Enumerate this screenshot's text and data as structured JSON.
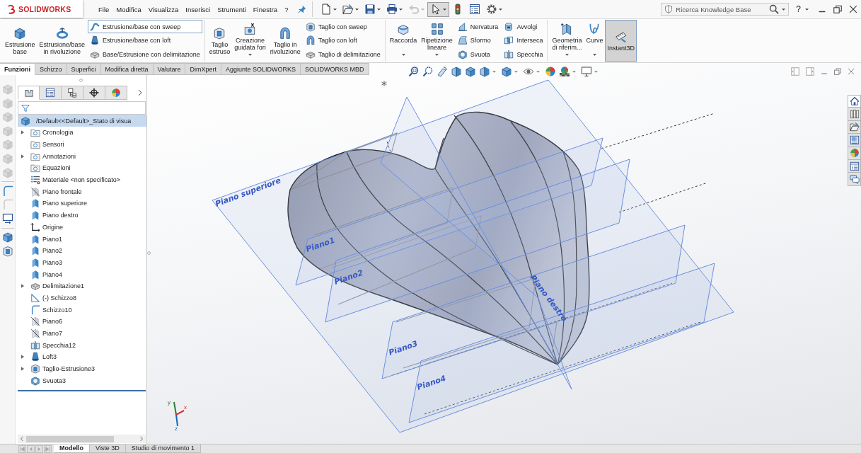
{
  "title_bar": {
    "logo": "SOLIDWORKS",
    "menu": [
      "File",
      "Modifica",
      "Visualizza",
      "Inserisci",
      "Strumenti",
      "Finestra",
      "?"
    ],
    "quick_access": [
      {
        "dropdown": true,
        "disabled": false,
        "selected": false
      },
      {
        "dropdown": true,
        "disabled": false,
        "selected": false
      },
      {
        "dropdown": true,
        "disabled": false,
        "selected": false
      },
      {
        "dropdown": true,
        "disabled": false,
        "selected": false
      },
      {
        "dropdown": true,
        "disabled": true,
        "selected": false
      },
      {
        "dropdown": true,
        "disabled": false,
        "selected": true
      },
      {
        "dropdown": false,
        "disabled": false,
        "selected": false
      },
      {
        "dropdown": false,
        "disabled": false,
        "selected": false
      },
      {
        "dropdown": true,
        "disabled": false,
        "selected": false
      }
    ],
    "search": {
      "placeholder": "Ricerca Knowledge Base"
    },
    "help": "?"
  },
  "command_manager": {
    "groups": [
      {
        "items": [
          {
            "kind": "large",
            "lines": [
              "Estrusione",
              "base"
            ],
            "dropdown": false,
            "on": false
          },
          {
            "kind": "large",
            "lines": [
              "Estrusione/base",
              "in rivoluzione"
            ],
            "dropdown": false,
            "on": false
          },
          {
            "kind": "stack",
            "entries": [
              {
                "label": "Estrusione/base con sweep",
                "highlighted": true
              },
              {
                "label": "Estrusione/base con loft",
                "highlighted": false
              },
              {
                "label": "Base/Estrusione con delimitazione",
                "highlighted": false
              }
            ]
          }
        ]
      },
      {
        "items": [
          {
            "kind": "large",
            "lines": [
              "Taglio",
              "estruso"
            ],
            "dropdown": false,
            "on": false
          },
          {
            "kind": "large",
            "lines": [
              "Creazione",
              "guidata fori"
            ],
            "dropdown": true,
            "on": false
          },
          {
            "kind": "large",
            "lines": [
              "Taglio in",
              "rivoluzione"
            ],
            "dropdown": false,
            "on": false
          },
          {
            "kind": "stack",
            "entries": [
              {
                "label": "Taglio con sweep",
                "highlighted": false
              },
              {
                "label": "Taglio con loft",
                "highlighted": false
              },
              {
                "label": "Taglio di delimitazione",
                "highlighted": false
              }
            ]
          }
        ]
      },
      {
        "items": [
          {
            "kind": "large",
            "lines": [
              "Raccorda"
            ],
            "dropdown": true,
            "on": false
          },
          {
            "kind": "large",
            "lines": [
              "Ripetizione",
              "lineare"
            ],
            "dropdown": true,
            "on": false
          },
          {
            "kind": "stack",
            "entries": [
              {
                "label": "Nervatura",
                "highlighted": false
              },
              {
                "label": "Sformo",
                "highlighted": false
              },
              {
                "label": "Svuota",
                "highlighted": false
              }
            ]
          },
          {
            "kind": "stack",
            "entries": [
              {
                "label": "Avvolgi",
                "highlighted": false
              },
              {
                "label": "Interseca",
                "highlighted": false
              },
              {
                "label": "Specchia",
                "highlighted": false
              }
            ]
          }
        ]
      },
      {
        "items": [
          {
            "kind": "large",
            "lines": [
              "Geometria",
              "di riferim..."
            ],
            "dropdown": true,
            "on": false
          },
          {
            "kind": "large",
            "lines": [
              "Curve"
            ],
            "dropdown": true,
            "on": false
          },
          {
            "kind": "large",
            "lines": [
              "Instant3D"
            ],
            "dropdown": false,
            "on": true
          }
        ]
      }
    ]
  },
  "command_tabs": [
    {
      "label": "Funzioni",
      "selected": true
    },
    {
      "label": "Schizzo",
      "selected": false
    },
    {
      "label": "Superfici",
      "selected": false
    },
    {
      "label": "Modifica diretta",
      "selected": false
    },
    {
      "label": "Valutare",
      "selected": false
    },
    {
      "label": "DimXpert",
      "selected": false
    },
    {
      "label": "Aggiunte SOLIDWORKS",
      "selected": false
    },
    {
      "label": "SOLIDWORKS MBD",
      "selected": false
    }
  ],
  "side_toolbar": [
    {
      "disabled": true
    },
    {
      "disabled": true
    },
    {
      "disabled": true
    },
    {
      "disabled": true
    },
    {
      "disabled": true
    },
    {
      "disabled": true
    },
    {
      "disabled": true
    },
    {
      "disabled": false
    },
    {
      "disabled": true
    },
    {
      "disabled": false
    },
    {
      "disabled": false
    },
    {
      "disabled": false
    }
  ],
  "feature_manager": {
    "tabs": [
      {
        "selected": true
      },
      {
        "selected": false
      },
      {
        "selected": false
      },
      {
        "selected": false
      },
      {
        "selected": false
      }
    ],
    "root": {
      "label": "/Default<<Default>_Stato di visua",
      "selected": true
    },
    "items": [
      {
        "label": "Cronologia",
        "kind": "folder",
        "has_children": true,
        "hidden": false,
        "selected": false
      },
      {
        "label": "Sensori",
        "kind": "folder",
        "has_children": false,
        "hidden": false,
        "selected": false
      },
      {
        "label": "Annotazioni",
        "kind": "folder",
        "has_children": true,
        "hidden": false,
        "selected": false
      },
      {
        "label": "Equazioni",
        "kind": "folder",
        "has_children": false,
        "hidden": false,
        "selected": false
      },
      {
        "label": "Materiale <non specificato>",
        "kind": "material",
        "has_children": false,
        "hidden": false,
        "selected": false
      },
      {
        "label": "Piano frontale",
        "kind": "plane",
        "has_children": false,
        "hidden": true,
        "selected": false
      },
      {
        "label": "Piano superiore",
        "kind": "plane",
        "has_children": false,
        "hidden": false,
        "selected": false
      },
      {
        "label": "Piano destro",
        "kind": "plane",
        "has_children": false,
        "hidden": false,
        "selected": false
      },
      {
        "label": "Origine",
        "kind": "origin",
        "has_children": false,
        "hidden": false,
        "selected": false
      },
      {
        "label": "Piano1",
        "kind": "plane",
        "has_children": false,
        "hidden": false,
        "selected": false
      },
      {
        "label": "Piano2",
        "kind": "plane",
        "has_children": false,
        "hidden": false,
        "selected": false
      },
      {
        "label": "Piano3",
        "kind": "plane",
        "has_children": false,
        "hidden": false,
        "selected": false
      },
      {
        "label": "Piano4",
        "kind": "plane",
        "has_children": false,
        "hidden": false,
        "selected": false
      },
      {
        "label": "Delimitazione1",
        "kind": "boundary",
        "has_children": true,
        "hidden": false,
        "selected": false
      },
      {
        "label": "(-) Schizzo8",
        "kind": "sketch3d",
        "has_children": false,
        "hidden": false,
        "selected": false
      },
      {
        "label": "Schizzo10",
        "kind": "sketch",
        "has_children": false,
        "hidden": false,
        "selected": false
      },
      {
        "label": "Piano6",
        "kind": "plane",
        "has_children": false,
        "hidden": true,
        "selected": false
      },
      {
        "label": "Piano7",
        "kind": "plane",
        "has_children": false,
        "hidden": true,
        "selected": false
      },
      {
        "label": "Specchia12",
        "kind": "mirror",
        "has_children": false,
        "hidden": false,
        "selected": false
      },
      {
        "label": "Loft3",
        "kind": "loft",
        "has_children": true,
        "hidden": false,
        "selected": false
      },
      {
        "label": "Taglio-Estrusione3",
        "kind": "cut",
        "has_children": true,
        "hidden": false,
        "selected": false
      },
      {
        "label": "Svuota3",
        "kind": "shell",
        "has_children": false,
        "hidden": false,
        "selected": false
      }
    ]
  },
  "bottom_tabs": [
    {
      "label": "Modello",
      "selected": true
    },
    {
      "label": "Viste 3D",
      "selected": false
    },
    {
      "label": "Studio di movimento 1",
      "selected": false
    }
  ],
  "viewport": {
    "plane_labels": [
      "Piano superiore",
      "Piano1",
      "Piano2",
      "Piano3",
      "Piano4",
      "Piano destro"
    ],
    "triad_axes": [
      "x",
      "y",
      "z"
    ]
  },
  "task_pane": [
    {
      "selected": true
    },
    {
      "selected": false
    },
    {
      "selected": false
    },
    {
      "selected": false
    },
    {
      "selected": false
    },
    {
      "selected": false
    },
    {
      "selected": false
    }
  ]
}
